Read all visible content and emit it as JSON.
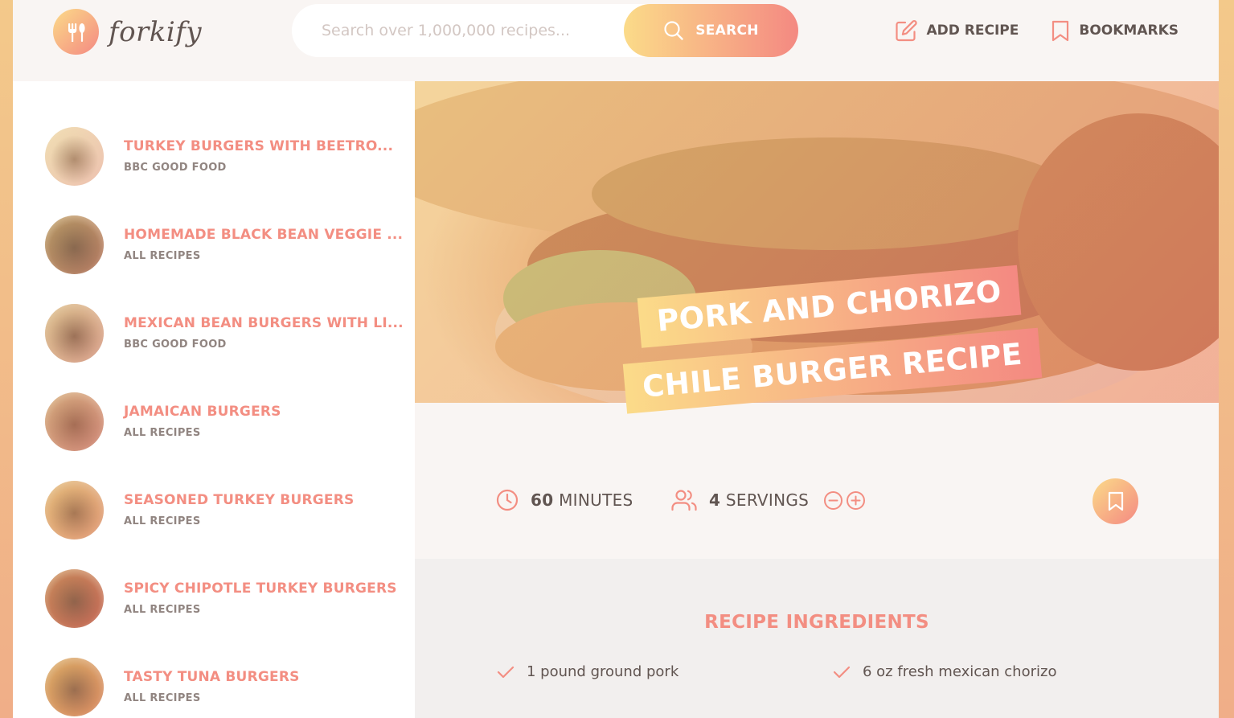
{
  "header": {
    "logo_text": "forkify",
    "search_placeholder": "Search over 1,000,000 recipes...",
    "search_button": "SEARCH",
    "nav": {
      "add_recipe": "ADD RECIPE",
      "bookmarks": "BOOKMARKS"
    }
  },
  "results": [
    {
      "title": "TURKEY BURGERS WITH BEETRO...",
      "publisher": "BBC GOOD FOOD",
      "colors": [
        "#e9dfc7",
        "#8c7b63"
      ]
    },
    {
      "title": "HOMEMADE BLACK BEAN VEGGIE ...",
      "publisher": "ALL RECIPES",
      "colors": [
        "#8c6f4f",
        "#4e4232"
      ]
    },
    {
      "title": "MEXICAN BEAN BURGERS WITH LI...",
      "publisher": "BBC GOOD FOOD",
      "colors": [
        "#c5a98c",
        "#6c5140"
      ]
    },
    {
      "title": "JAMAICAN BURGERS",
      "publisher": "ALL RECIPES",
      "colors": [
        "#b98670",
        "#7a4a3b"
      ]
    },
    {
      "title": "SEASONED TURKEY BURGERS",
      "publisher": "ALL RECIPES",
      "colors": [
        "#d3a36f",
        "#7d5a3b"
      ]
    },
    {
      "title": "SPICY CHIPOTLE TURKEY BURGERS",
      "publisher": "ALL RECIPES",
      "colors": [
        "#a8593f",
        "#5a3a2c"
      ]
    },
    {
      "title": "TASTY TUNA BURGERS",
      "publisher": "ALL RECIPES",
      "colors": [
        "#c48a4f",
        "#6a4b33"
      ]
    }
  ],
  "recipe": {
    "title_line1": "PORK AND CHORIZO",
    "title_line2": "CHILE BURGER RECIPE",
    "minutes_value": "60",
    "minutes_label": "MINUTES",
    "servings_value": "4",
    "servings_label": "SERVINGS",
    "ingredients_heading": "RECIPE INGREDIENTS",
    "ingredients": [
      "1 pound ground pork",
      "6 oz fresh mexican chorizo"
    ]
  },
  "colors": {
    "accent_start": "#fbdb89",
    "accent_end": "#f48982",
    "text": "#615551",
    "title": "#f38e82"
  }
}
